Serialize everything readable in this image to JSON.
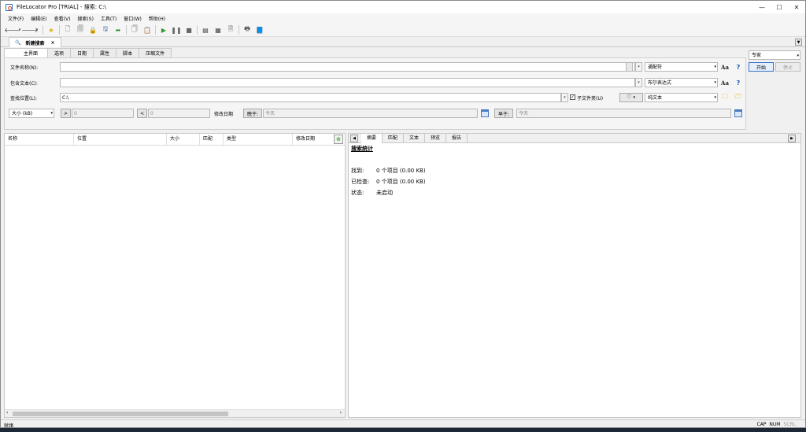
{
  "window": {
    "title": "FileLocator Pro [TRIAL] - 搜索: C:\\",
    "controls": {
      "minimize": "—",
      "maximize": "☐",
      "close": "✕"
    }
  },
  "menu": [
    "文件(F)",
    "编辑(E)",
    "查看(V)",
    "搜索(S)",
    "工具(T)",
    "窗口(W)",
    "帮助(H)"
  ],
  "toolbar": {
    "icons": [
      "back-arrow-icon",
      "forward-arrow-icon",
      "favorites-star-icon",
      "new-document-icon",
      "open-icon",
      "lock-icon",
      "save-icon",
      "export-icon",
      "copy-icon",
      "paste-icon",
      "play-icon",
      "pause-icon",
      "stop-icon",
      "view-list-icon",
      "view-details-icon",
      "view-preview-icon",
      "print-icon",
      "book-icon"
    ]
  },
  "doc_tab": {
    "label": "新建搜索",
    "close": "×"
  },
  "criteria_tabs": [
    "主界面",
    "选项",
    "日期",
    "属性",
    "脚本",
    "压缩文件"
  ],
  "form": {
    "filename_label": "文件名称(N):",
    "filename_value": "",
    "filename_mode": "通配符",
    "contains_label": "包含文本(C):",
    "contains_value": "",
    "contains_mode": "布尔表达式",
    "lookin_label": "查找位置(L):",
    "lookin_value": "C:\\",
    "subfolders_label": "子文件夹(U)",
    "subfolders_checked": "✓",
    "filetype_value": "纯文本",
    "size_label": "大小 (kB)",
    "size_gt_op": ">",
    "size_gt_value": "0",
    "size_lt_op": "<",
    "size_lt_value": "0",
    "modified_label": "修改日期",
    "after_label": "晚于:",
    "after_value": "今天",
    "before_label": "早于:",
    "before_value": "今天",
    "case_icon_label": "Aa",
    "help_label": "?"
  },
  "side": {
    "profile": "专家",
    "start_label": "开始",
    "stop_label": "停止"
  },
  "results": {
    "columns": [
      "名称",
      "位置",
      "大小",
      "匹配",
      "类型",
      "修改日期"
    ]
  },
  "preview": {
    "tabs": [
      "摘要",
      "匹配",
      "文本",
      "预览",
      "报告"
    ],
    "heading": "搜索统计",
    "stats": [
      {
        "label": "找到:",
        "value": "0 个项目 (0.00 KB)"
      },
      {
        "label": "已检查:",
        "value": "0 个项目 (0.00 KB)"
      },
      {
        "label": "状态:",
        "value": "未启动"
      }
    ]
  },
  "status": {
    "left": "就绪",
    "cap": "CAP",
    "num": "NUM",
    "scrl": "SCRL"
  }
}
